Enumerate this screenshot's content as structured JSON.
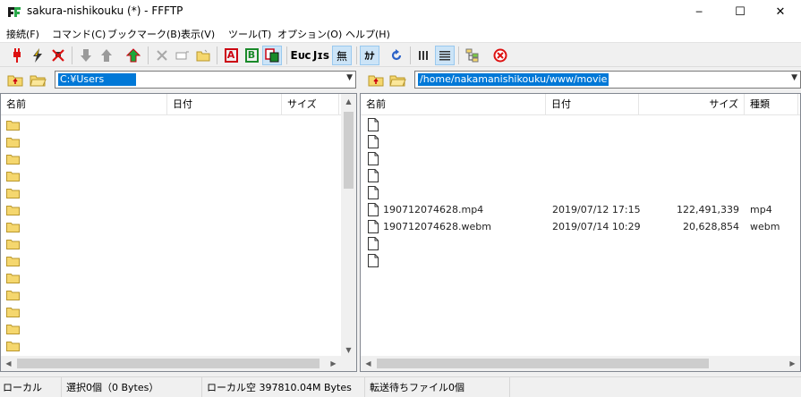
{
  "window": {
    "title": "sakura-nishikouku (*) - FFFTP",
    "min_glyph": "─",
    "max_glyph": "☐",
    "close_glyph": "✕"
  },
  "menu": [
    "接続(F)",
    "コマンド(C)",
    "ブックマーク(B)",
    "表示(V)",
    "ツール(T)",
    "オプション(O)",
    "ヘルプ(H)"
  ],
  "toolbar": {
    "glyph_a": "A",
    "glyph_b": "B",
    "glyph_euc": "Eᴜc",
    "glyph_jis": "Jɪs",
    "glyph_none": "無",
    "glyph_kana": "ｶﾅ"
  },
  "local": {
    "path": "C:¥Users",
    "columns": [
      "名前",
      "日付",
      "サイズ"
    ],
    "folder_rows": 14
  },
  "remote": {
    "path": "/home/nakamanishikouku/www/movie",
    "columns": [
      "名前",
      "日付",
      "サイズ",
      "種類"
    ],
    "rows": [
      {
        "name": "",
        "date": "",
        "size": "",
        "type": ""
      },
      {
        "name": "",
        "date": "",
        "size": "",
        "type": ""
      },
      {
        "name": "",
        "date": "",
        "size": "",
        "type": ""
      },
      {
        "name": "",
        "date": "",
        "size": "",
        "type": ""
      },
      {
        "name": "",
        "date": "",
        "size": "",
        "type": ""
      },
      {
        "name": "190712074628.mp4",
        "date": "2019/07/12 17:15",
        "size": "122,491,339",
        "type": "mp4"
      },
      {
        "name": "190712074628.webm",
        "date": "2019/07/14 10:29",
        "size": "20,628,854",
        "type": "webm"
      },
      {
        "name": "",
        "date": "",
        "size": "",
        "type": ""
      },
      {
        "name": "",
        "date": "",
        "size": "",
        "type": ""
      }
    ]
  },
  "status": {
    "mode": "ローカル",
    "selection": "選択0個（0 Bytes）",
    "free": "ローカル空 397810.04M Bytes",
    "queue": "転送待ちファイル0個"
  },
  "colors": {
    "selection": "#0078d7",
    "toggle_on": "#cce4f7",
    "folder": "#f5d76e"
  }
}
